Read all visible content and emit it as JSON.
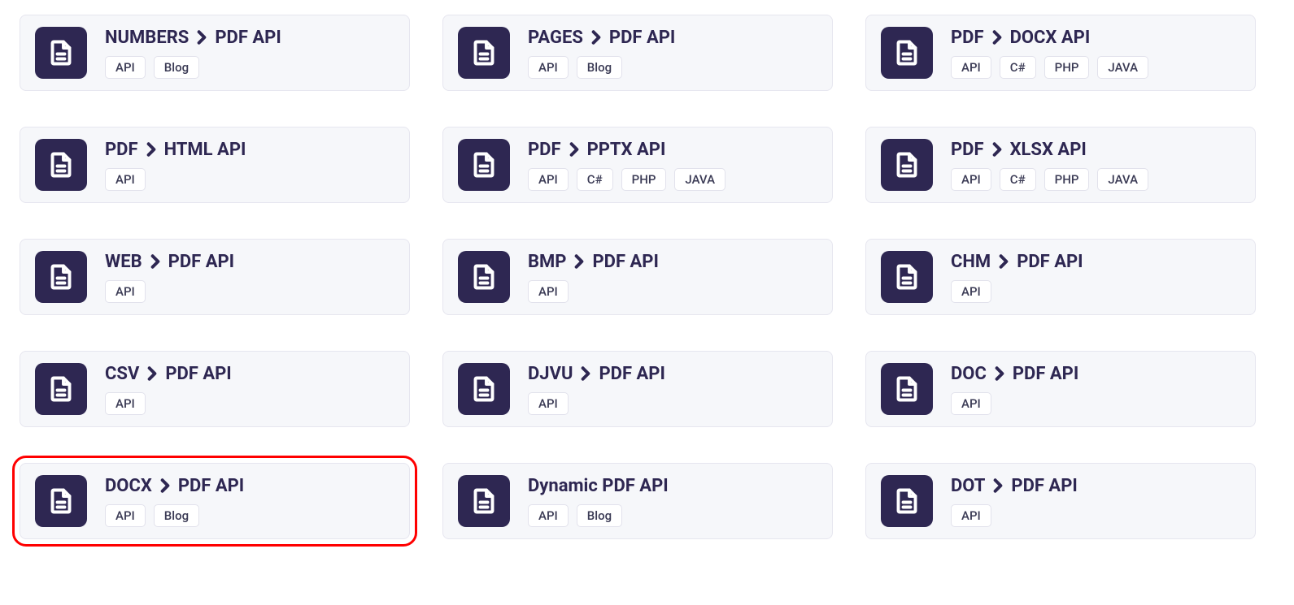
{
  "cards": [
    {
      "from": "NUMBERS",
      "to": "PDF API",
      "plain": null,
      "tags": [
        "API",
        "Blog"
      ],
      "highlighted": false
    },
    {
      "from": "PAGES",
      "to": "PDF API",
      "plain": null,
      "tags": [
        "API",
        "Blog"
      ],
      "highlighted": false
    },
    {
      "from": "PDF",
      "to": "DOCX API",
      "plain": null,
      "tags": [
        "API",
        "C#",
        "PHP",
        "JAVA"
      ],
      "highlighted": false
    },
    {
      "from": "PDF",
      "to": "HTML API",
      "plain": null,
      "tags": [
        "API"
      ],
      "highlighted": false
    },
    {
      "from": "PDF",
      "to": "PPTX API",
      "plain": null,
      "tags": [
        "API",
        "C#",
        "PHP",
        "JAVA"
      ],
      "highlighted": false
    },
    {
      "from": "PDF",
      "to": "XLSX API",
      "plain": null,
      "tags": [
        "API",
        "C#",
        "PHP",
        "JAVA"
      ],
      "highlighted": false
    },
    {
      "from": "WEB",
      "to": "PDF API",
      "plain": null,
      "tags": [
        "API"
      ],
      "highlighted": false
    },
    {
      "from": "BMP",
      "to": "PDF API",
      "plain": null,
      "tags": [
        "API"
      ],
      "highlighted": false
    },
    {
      "from": "CHM",
      "to": "PDF API",
      "plain": null,
      "tags": [
        "API"
      ],
      "highlighted": false
    },
    {
      "from": "CSV",
      "to": "PDF API",
      "plain": null,
      "tags": [
        "API"
      ],
      "highlighted": false
    },
    {
      "from": "DJVU",
      "to": "PDF API",
      "plain": null,
      "tags": [
        "API"
      ],
      "highlighted": false
    },
    {
      "from": "DOC",
      "to": "PDF API",
      "plain": null,
      "tags": [
        "API"
      ],
      "highlighted": false
    },
    {
      "from": "DOCX",
      "to": "PDF API",
      "plain": null,
      "tags": [
        "API",
        "Blog"
      ],
      "highlighted": true
    },
    {
      "from": null,
      "to": null,
      "plain": "Dynamic PDF API",
      "tags": [
        "API",
        "Blog"
      ],
      "highlighted": false
    },
    {
      "from": "DOT",
      "to": "PDF API",
      "plain": null,
      "tags": [
        "API"
      ],
      "highlighted": false
    }
  ]
}
